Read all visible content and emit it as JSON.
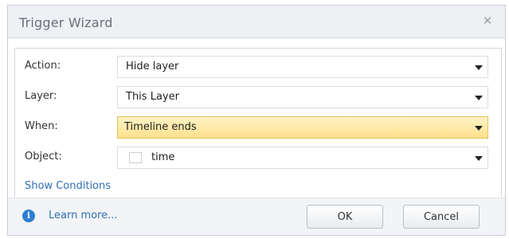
{
  "dialog": {
    "title": "Trigger Wizard",
    "close_glyph": "✕"
  },
  "fields": {
    "action": {
      "label": "Action:",
      "value": "Hide layer"
    },
    "layer": {
      "label": "Layer:",
      "value": "This Layer"
    },
    "when": {
      "label": "When:",
      "value": "Timeline ends"
    },
    "object": {
      "label": "Object:",
      "value": "time"
    }
  },
  "links": {
    "show_conditions": "Show Conditions",
    "learn_more": "Learn more..."
  },
  "buttons": {
    "ok": "OK",
    "cancel": "Cancel"
  },
  "icons": {
    "info": "i",
    "info_icon_name": "info-icon",
    "dropdown_icon_name": "chevron-down-icon",
    "close_icon_name": "close-icon"
  },
  "colors": {
    "accent": "#2f6fb5",
    "highlight": "#ffe18c"
  }
}
